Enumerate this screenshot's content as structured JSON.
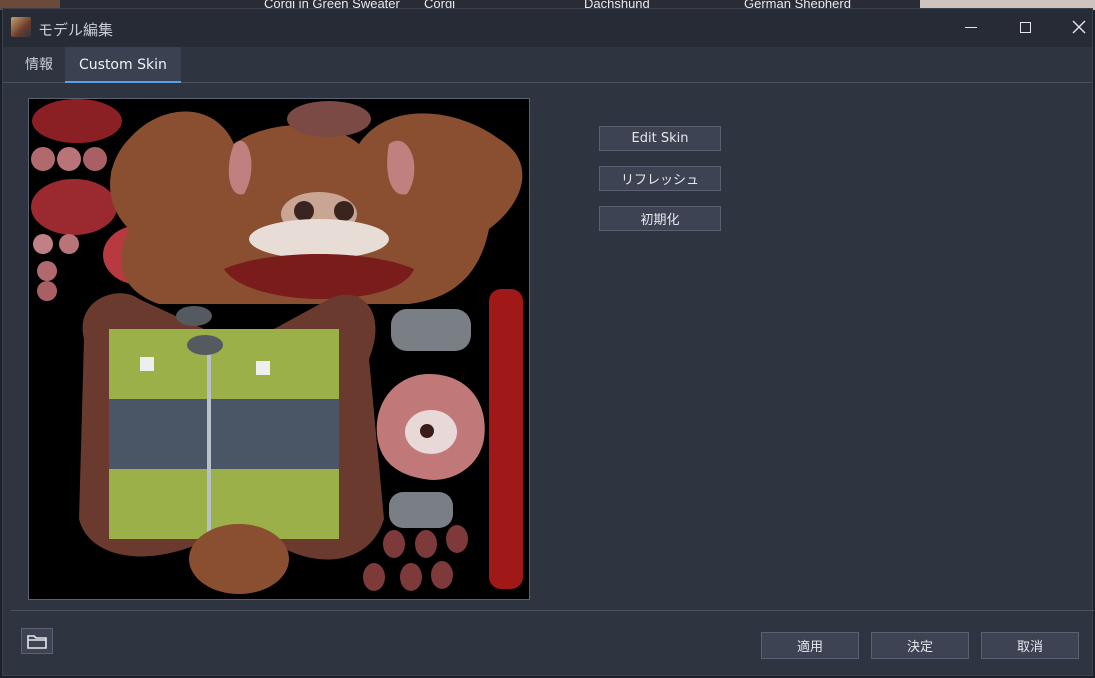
{
  "background_tabs": [
    "Corgi in Green Sweater",
    "Corgi",
    "Dachshund",
    "German Shepherd"
  ],
  "window": {
    "title": "モデル編集",
    "icons": {
      "app": "app-icon",
      "minimize": "minimize-icon",
      "maximize": "maximize-icon",
      "close": "close-icon"
    }
  },
  "tabs": [
    {
      "label": "情報",
      "active": false
    },
    {
      "label": "Custom Skin",
      "active": true
    }
  ],
  "skin_panel": {
    "buttons": {
      "edit_skin": "Edit Skin",
      "refresh": "リフレッシュ",
      "reset": "初期化"
    }
  },
  "footer": {
    "folder_icon": "folder-icon",
    "apply": "適用",
    "ok": "決定",
    "cancel": "取消"
  },
  "colors": {
    "accent": "#5aa0e6",
    "window_bg": "#2e3440",
    "button_bg": "#3d4353"
  }
}
